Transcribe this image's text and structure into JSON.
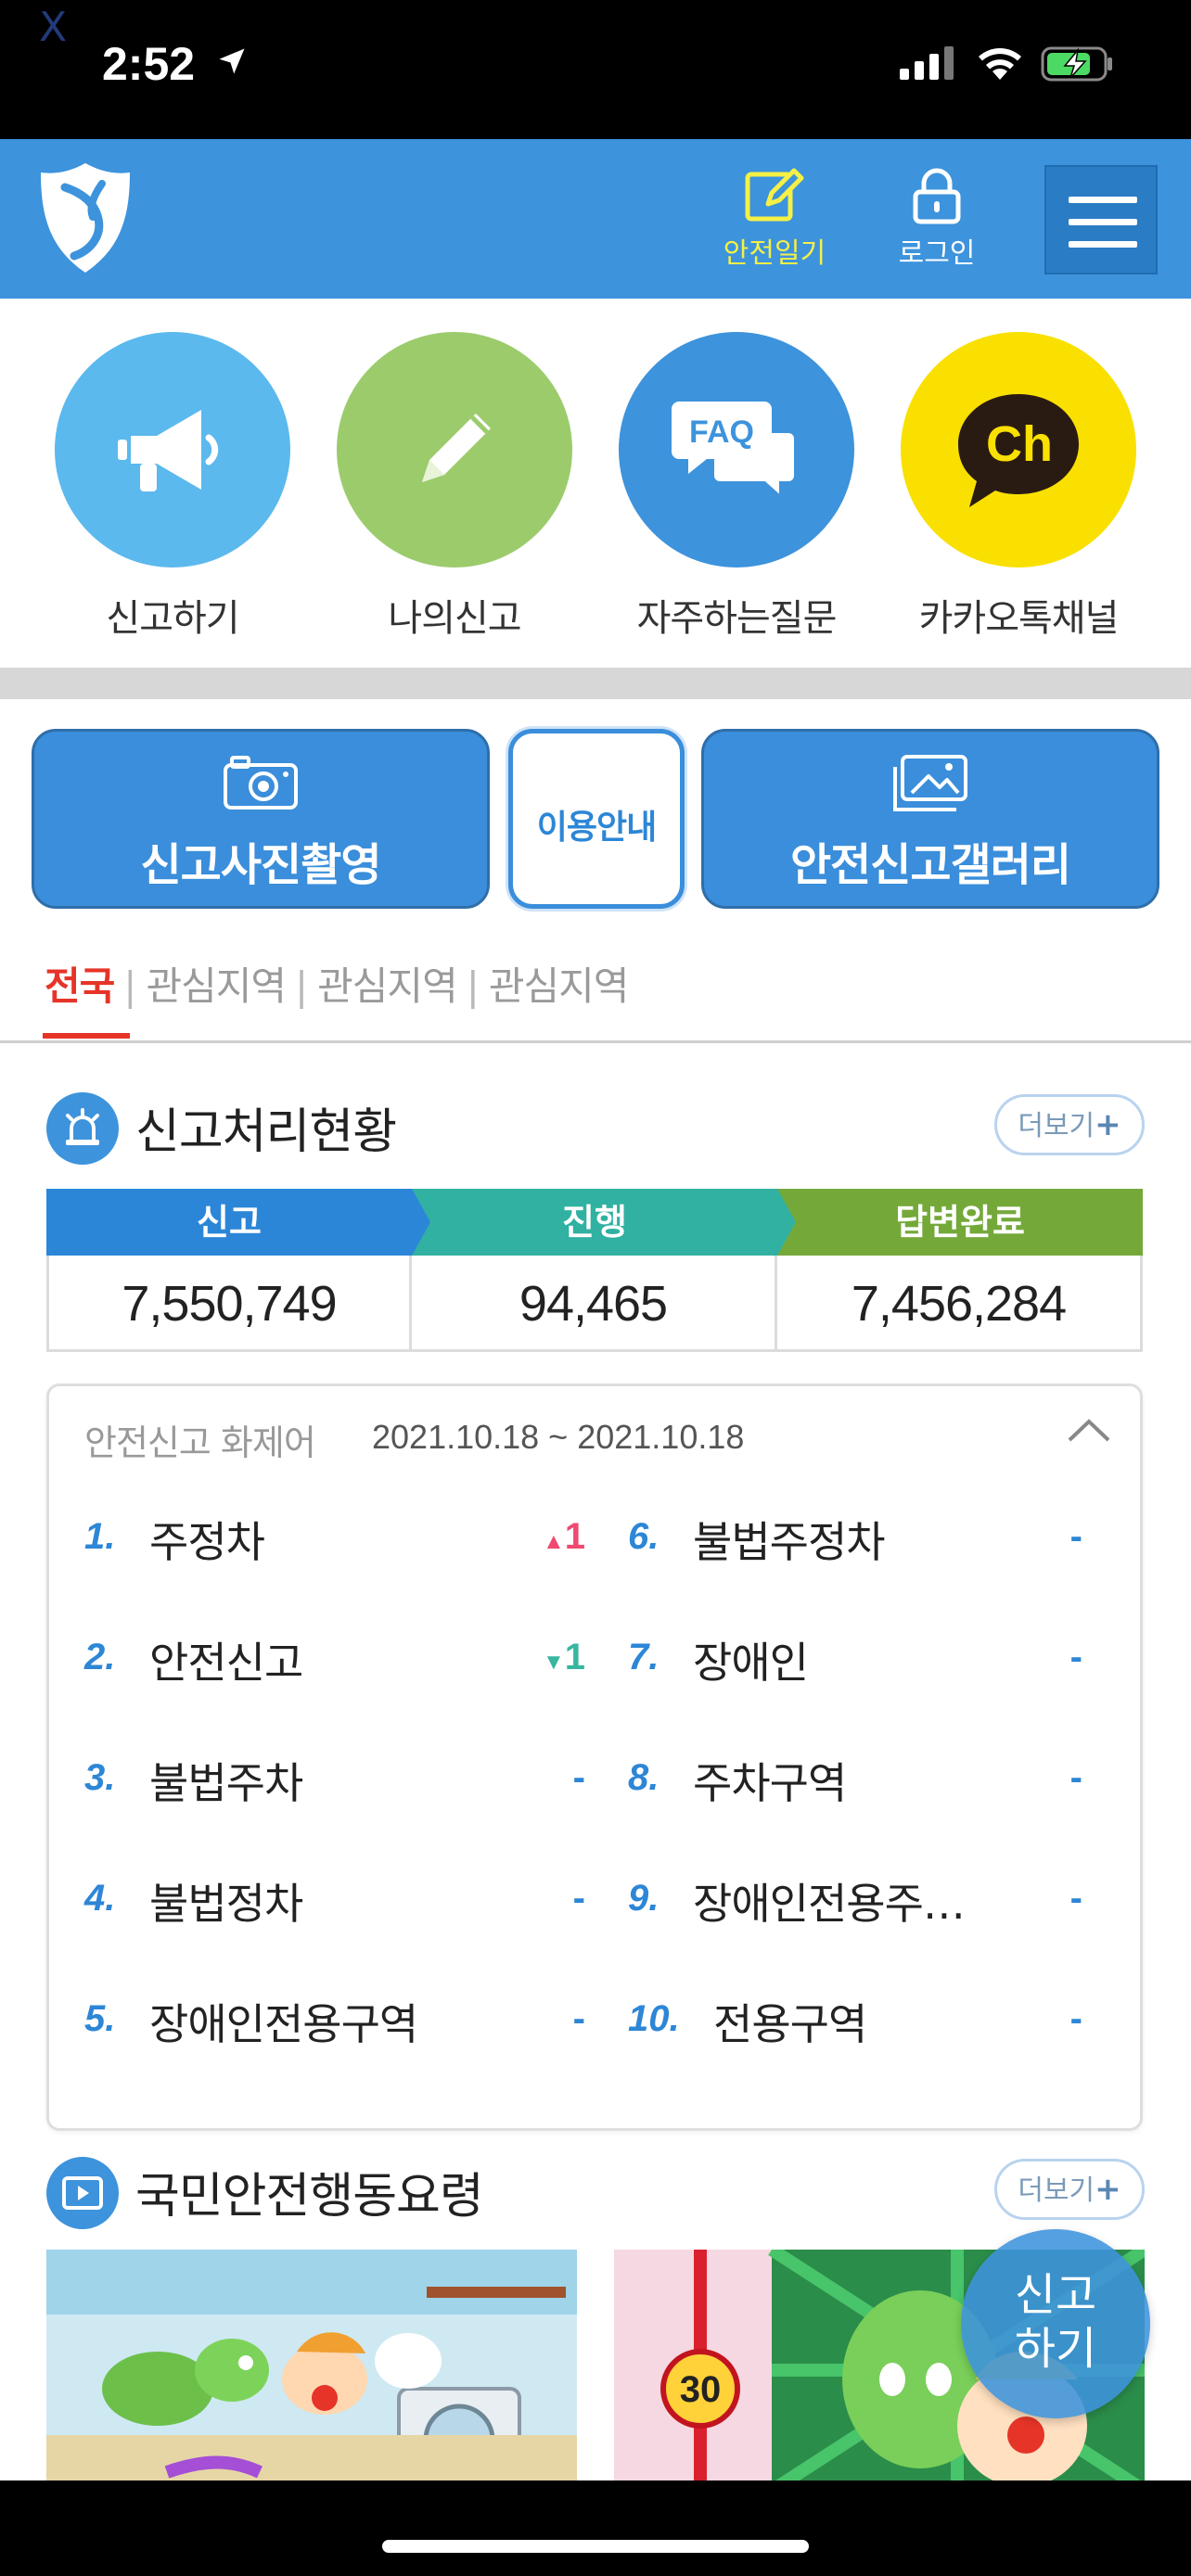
{
  "status": {
    "debug_mark": "X",
    "time": "2:52"
  },
  "header": {
    "diary_label": "안전일기",
    "login_label": "로그인",
    "colors": {
      "bar": "#3d93dc",
      "diary": "#f4f046"
    }
  },
  "quick_menu": [
    {
      "label": "신고하기",
      "icon": "megaphone-icon"
    },
    {
      "label": "나의신고",
      "icon": "pencil-icon"
    },
    {
      "label": "자주하는질문",
      "icon": "faq-icon"
    },
    {
      "label": "카카오톡채널",
      "icon": "kakao-channel-icon"
    }
  ],
  "faq_icon_text": "FAQ",
  "kakao_icon_text": "Ch",
  "actions": {
    "camera_label": "신고사진촬영",
    "guide_label": "이용안내",
    "gallery_label": "안전신고갤러리"
  },
  "region_tabs": [
    {
      "label": "전국",
      "active": true
    },
    {
      "label": "관심지역",
      "active": false
    },
    {
      "label": "관심지역",
      "active": false
    },
    {
      "label": "관심지역",
      "active": false
    }
  ],
  "tab_separator": "|",
  "report_status": {
    "title": "신고처리현황",
    "more_label": "더보기",
    "more_plus": "+",
    "columns": [
      {
        "label": "신고",
        "value": "7,550,749",
        "color": "#2c86d8"
      },
      {
        "label": "진행",
        "value": "94,465",
        "color": "#30b1a2"
      },
      {
        "label": "답변완료",
        "value": "7,456,284",
        "color": "#74a93a"
      }
    ]
  },
  "trending": {
    "title": "안전신고 화제어",
    "date_range": "2021.10.18 ~ 2021.10.18",
    "items": [
      {
        "rank": "1.",
        "keyword": "주정차",
        "change": "1",
        "direction": "up"
      },
      {
        "rank": "2.",
        "keyword": "안전신고",
        "change": "1",
        "direction": "down"
      },
      {
        "rank": "3.",
        "keyword": "불법주차",
        "change": "-",
        "direction": "none"
      },
      {
        "rank": "4.",
        "keyword": "불법정차",
        "change": "-",
        "direction": "none"
      },
      {
        "rank": "5.",
        "keyword": "장애인전용구역",
        "change": "-",
        "direction": "none"
      },
      {
        "rank": "6.",
        "keyword": "불법주정차",
        "change": "-",
        "direction": "none"
      },
      {
        "rank": "7.",
        "keyword": "장애인",
        "change": "-",
        "direction": "none"
      },
      {
        "rank": "8.",
        "keyword": "주차구역",
        "change": "-",
        "direction": "none"
      },
      {
        "rank": "9.",
        "keyword": "장애인전용주…",
        "change": "-",
        "direction": "none"
      },
      {
        "rank": "10.",
        "keyword": "전용구역",
        "change": "-",
        "direction": "none"
      }
    ]
  },
  "safety_guide": {
    "title": "국민안전행동요령",
    "more_label": "더보기",
    "more_plus": "+",
    "thumb2_number": "30"
  },
  "fab": {
    "line1": "신고",
    "line2": "하기"
  }
}
